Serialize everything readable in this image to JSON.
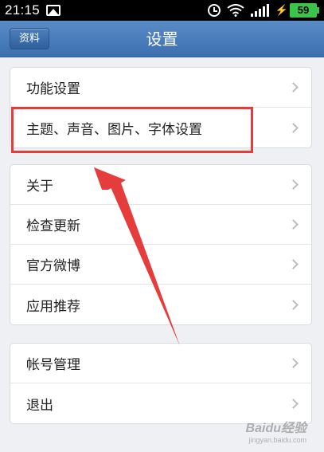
{
  "status_bar": {
    "time": "21:15",
    "battery": "59",
    "icons": [
      "image-icon",
      "alarm-icon",
      "wifi-icon",
      "signal-icon",
      "battery-icon"
    ]
  },
  "header": {
    "back_label": "资料",
    "title": "设置"
  },
  "groups": [
    {
      "items": [
        {
          "label": "功能设置"
        },
        {
          "label": "主题、声音、图片、字体设置"
        }
      ]
    },
    {
      "items": [
        {
          "label": "关于"
        },
        {
          "label": "检查更新"
        },
        {
          "label": "官方微博"
        },
        {
          "label": "应用推荐"
        }
      ]
    },
    {
      "items": [
        {
          "label": "帐号管理"
        },
        {
          "label": "退出"
        }
      ]
    }
  ],
  "watermark": {
    "text": "Baidu经验",
    "sub": "jingyan.baidu.com"
  },
  "colors": {
    "header": "#3b6faf",
    "annotation": "#e53c3c",
    "battery": "#3cc34a"
  }
}
